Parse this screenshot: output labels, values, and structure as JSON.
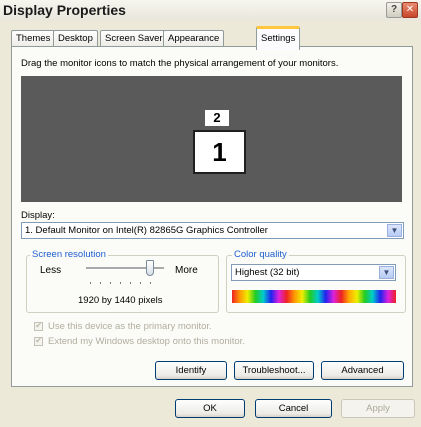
{
  "window": {
    "title": "Display Properties"
  },
  "tabs": [
    {
      "label": "Themes"
    },
    {
      "label": "Desktop"
    },
    {
      "label": "Screen Saver"
    },
    {
      "label": "Appearance"
    },
    {
      "label": "Settings"
    }
  ],
  "settings": {
    "instructions": "Drag the monitor icons to match the physical arrangement of your monitors.",
    "monitors": [
      "2",
      "1"
    ],
    "display_label": "Display:",
    "display_value": "1. Default Monitor on Intel(R) 82865G Graphics Controller",
    "resolution": {
      "group_title": "Screen resolution",
      "less_label": "Less",
      "more_label": "More",
      "value": "1920 by 1440 pixels"
    },
    "color_quality": {
      "group_title": "Color quality",
      "value": "Highest (32 bit)"
    },
    "checkboxes": [
      {
        "label": "Use this device as the primary monitor.",
        "checked": true,
        "disabled": true
      },
      {
        "label": "Extend my Windows desktop onto this monitor.",
        "checked": true,
        "disabled": true
      }
    ],
    "buttons": {
      "identify": "Identify",
      "troubleshoot": "Troubleshoot...",
      "advanced": "Advanced"
    }
  },
  "footer_buttons": {
    "ok": "OK",
    "cancel": "Cancel",
    "apply": "Apply"
  }
}
